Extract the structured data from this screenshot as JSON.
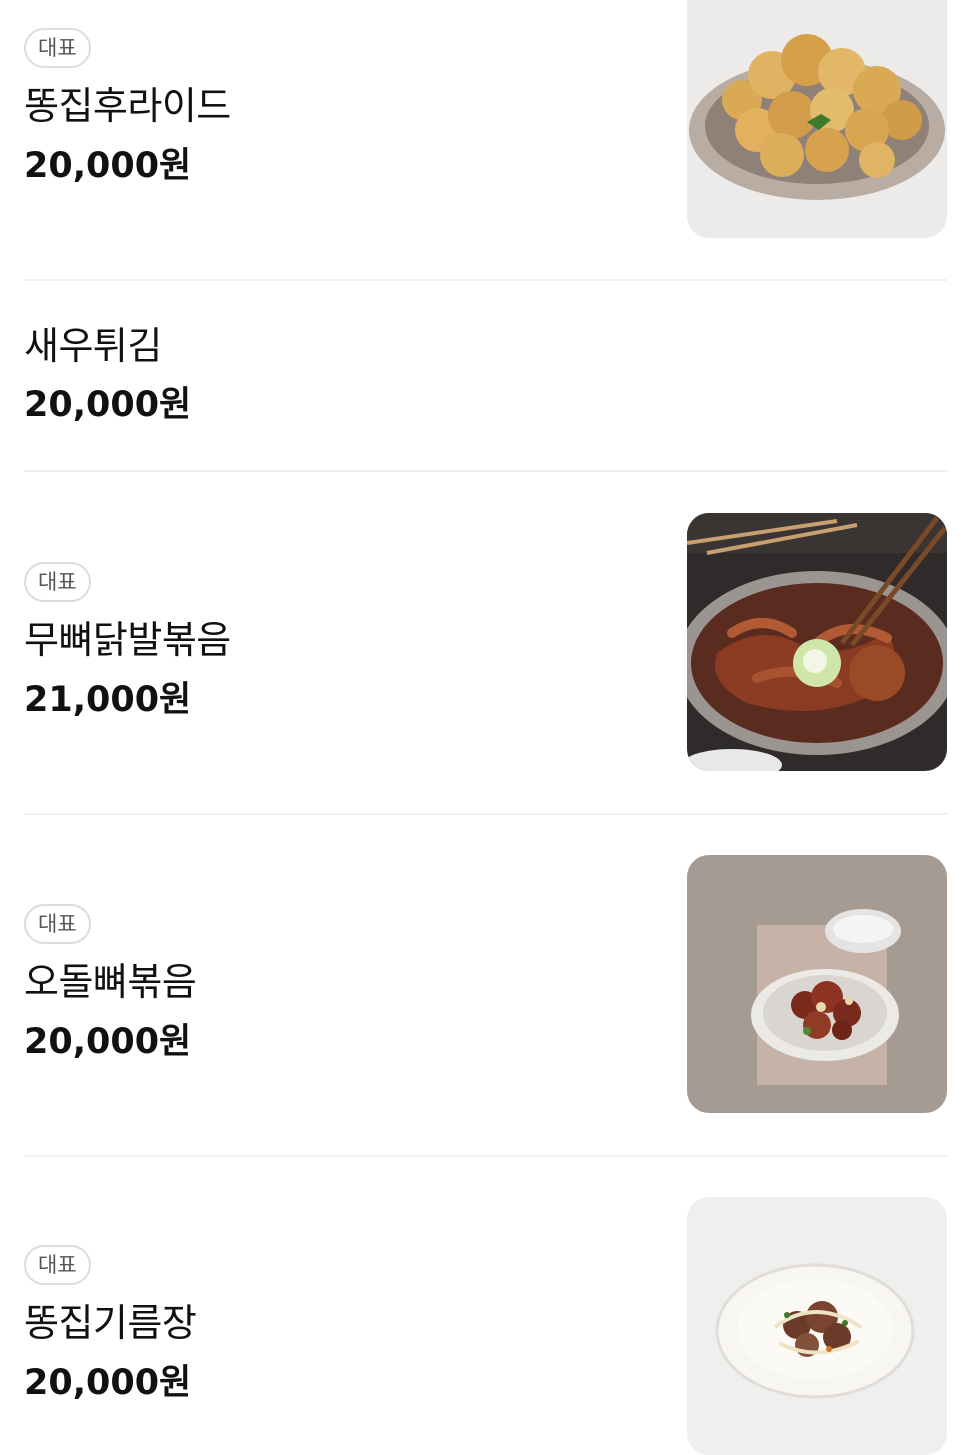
{
  "menu": {
    "items": [
      {
        "badge": "대표",
        "name": "똥집후라이드",
        "price": "20,000원",
        "image_icon": "fried-gizzard-photo"
      },
      {
        "badge": "",
        "name": "새우튀김",
        "price": "20,000원",
        "image_icon": ""
      },
      {
        "badge": "대표",
        "name": "무뼈닭발볶음",
        "price": "21,000원",
        "image_icon": "boneless-chicken-feet-photo"
      },
      {
        "badge": "대표",
        "name": "오돌뼈볶음",
        "price": "20,000원",
        "image_icon": "stir-fried-cartilage-photo"
      },
      {
        "badge": "대표",
        "name": "똥집기름장",
        "price": "20,000원",
        "image_icon": "gizzard-oil-sauce-photo"
      }
    ]
  },
  "colors": {
    "text": "#111111",
    "badge_border": "#dcdcdc",
    "badge_text": "#555555",
    "divider": "#f0f0f0",
    "background": "#ffffff"
  }
}
